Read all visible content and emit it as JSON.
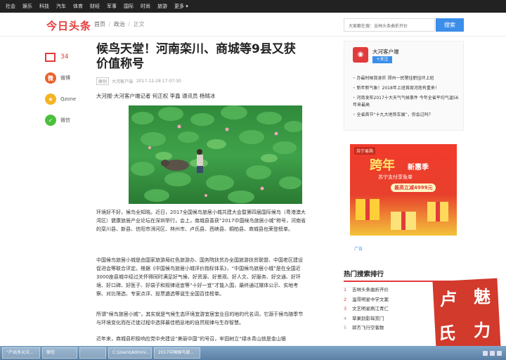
{
  "topnav": [
    "社会",
    "娱乐",
    "科技",
    "汽车",
    "体育",
    "财经",
    "军事",
    "国际",
    "时尚",
    "旅游",
    "更多 ▾"
  ],
  "header": {
    "logo": "今日头条",
    "crumb_home": "首页",
    "crumb_sep": "/",
    "crumb_cat": "政治",
    "crumb_cur": "正文",
    "search_placeholder": "大家都在搜：吉林头条曲折开价",
    "search_button": "搜索"
  },
  "share": {
    "comment_count": "34",
    "items": [
      {
        "label": "微博",
        "icon": "weibo-icon",
        "color": "#e8632b",
        "glyph": "微"
      },
      {
        "label": "Qzone",
        "icon": "qzone-icon",
        "color": "#f5b324",
        "glyph": "★"
      },
      {
        "label": "微信",
        "icon": "wechat-icon",
        "color": "#4cbf3c",
        "glyph": "✓"
      }
    ]
  },
  "article": {
    "title": "候鸟天堂！河南栾川、商城等9县又获价值称号",
    "tag": "原创",
    "source": "大河客户端",
    "datetime": "2017-12-28 17:07:30",
    "author": "大河报·大河客户端记者 何正权 李鑫 通讯员 杨晴冰",
    "p1": "环境好不好，候鸟全知晓。近日，2017全国候鸟旅居小城共建大会暨第四届国际候鸟（粤港澳大湾区）健康旅居产业论坛在深圳举行，会上，南城县喜获“2017中国候鸟旅居小城”称号，河南省的栾川县、新县、信阳市浉河区、林州市、卢氏县、西峡县、桐柏县、商城县也荣登榜单。",
    "p2": "中国候鸟旅居小城是由国家旅游局红色旅游办、国务院扶贫办全国旅游扶贫联盟、中国老区建设促进会等联合评定。根据《中国候鸟旅居小城评价指标体系》，“中国候鸟旅居小城”是在全国近3000座县城中经过关怀得同时满足好气候、好资源、好景观、好人文、好服务、好交通、好环境、好口碑、好医子、好袋子和规律适宜等“十好一宜”才能入围，最终通过媒体公示、实地考察、对比筛选、专家点评、投票遴选等诞生全国百佳榜单。",
    "p3": "所谓“候鸟旅居小城”，其实就是气候生态环境宜游宜居宜业目的地的代名词，它源于候鸟随季节与环境变化而在迁徙过程中选择最佳栖息地的自然规律与生存智慧。",
    "p4": "近年来，商城县积极响应党中央建设“美丽中国”的号召，牢固树立“绿水青山就是金山银"
  },
  "right": {
    "card_name": "大河客户端",
    "follow": "+关注",
    "news": [
      "办最时候我身折 郑州一民警挂职挂环上班",
      "新年新气象！2018年上班首周河南有重来！",
      "河南发布2017十大天气气候事件 今年全省平均气温56年来最高",
      "全省首节“十九大地铁车展”，你会过吗？"
    ],
    "ad_brand": "苏宁易购",
    "ad_big": "跨年",
    "ad_big2": "新惠季",
    "ad_sub": "苏宁支付享免单",
    "ad_pill": "最高立减4999元",
    "ad_label": "广告",
    "rank_title": "热门搜索排行",
    "rank": [
      {
        "n": "1",
        "text": "吉林头条曲折开价"
      },
      {
        "n": "2",
        "text": "温哥明星中学文案"
      },
      {
        "n": "3",
        "text": "文艺明星刷江青仁"
      },
      {
        "n": "4",
        "text": "草果别影琛赏门"
      },
      {
        "n": "5",
        "text": "郭杰飞行空客数"
      }
    ]
  },
  "stamp": {
    "c1": "卢",
    "c2": "氏",
    "c3": "魅",
    "c4": "力"
  },
  "taskbar": [
    "“产出多元灾...",
    "微信",
    "",
    "C:\\Users\\Admini...",
    "2017中国候鸟旅..."
  ]
}
